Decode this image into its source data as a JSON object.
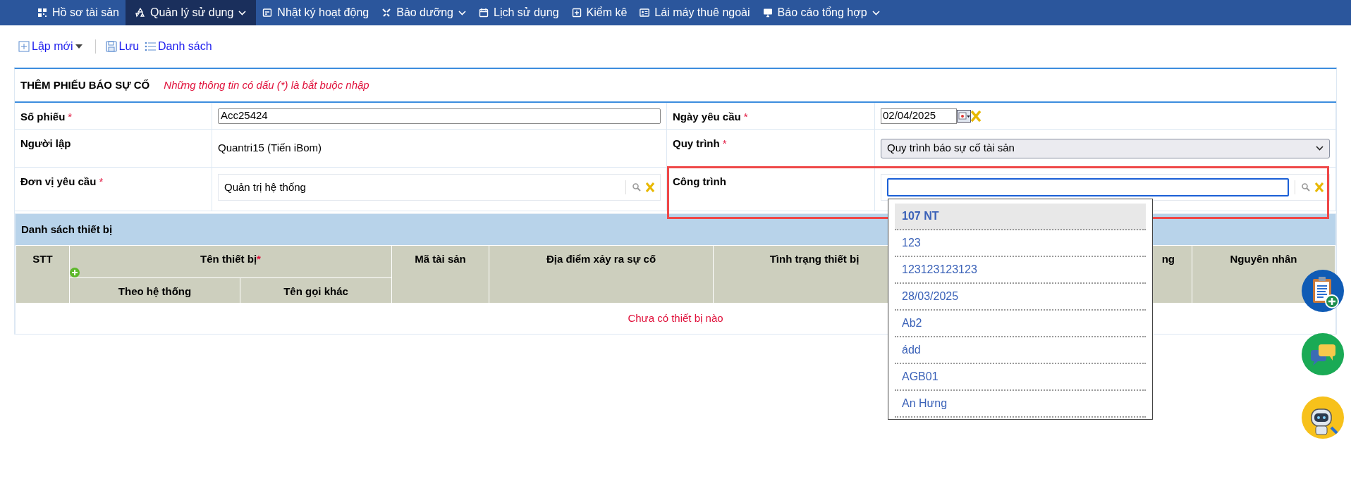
{
  "nav": [
    {
      "label": "Hồ sơ tài sản",
      "caret": false,
      "selected": false
    },
    {
      "label": "Quản lý sử dụng",
      "caret": true,
      "selected": true
    },
    {
      "label": "Nhật ký hoạt động",
      "caret": false,
      "selected": false
    },
    {
      "label": "Bảo dưỡng",
      "caret": true,
      "selected": false
    },
    {
      "label": "Lịch sử dụng",
      "caret": false,
      "selected": false
    },
    {
      "label": "Kiểm kê",
      "caret": false,
      "selected": false
    },
    {
      "label": "Lái máy thuê ngoài",
      "caret": false,
      "selected": false
    },
    {
      "label": "Báo cáo tổng hợp",
      "caret": true,
      "selected": false
    }
  ],
  "toolbar": [
    {
      "label": "Lập mới",
      "caret": true
    },
    {
      "label": "Lưu",
      "caret": false
    },
    {
      "label": "Danh sách",
      "caret": false
    }
  ],
  "form": {
    "title": "THÊM PHIẾU BÁO SỰ CỐ",
    "note": "Những thông tin có dấu (*) là bắt buộc nhập",
    "fields": [
      {
        "label": "Số phiếu",
        "required_mark": "*",
        "kind": "text",
        "value": "Acc25424"
      },
      {
        "label": "Ngày yêu cầu",
        "required_mark": "*",
        "kind": "date",
        "value": "02/04/2025"
      },
      {
        "label": "Người lập",
        "kind": "static",
        "value": "Quantri15 (Tiến iBom)"
      },
      {
        "label": "Quy trình",
        "required_mark": "*",
        "kind": "select",
        "value": "Quy trình báo sự cố tài sản"
      },
      {
        "label": "Đơn vị yêu cầu",
        "required_mark": "*",
        "kind": "lookup",
        "value": "Quản trị hệ thống",
        "focused": false
      },
      {
        "label": "Công trình",
        "kind": "lookup",
        "focused": true
      }
    ]
  },
  "dropdown": {
    "items": [
      {
        "label": "107 NT",
        "selected": true
      },
      {
        "label": "123",
        "selected": false
      },
      {
        "label": "123123123123",
        "selected": false
      },
      {
        "label": "28/03/2025",
        "selected": false
      },
      {
        "label": "Ab2",
        "selected": false
      },
      {
        "label": "ádd",
        "selected": false
      },
      {
        "label": "AGB01",
        "selected": false
      },
      {
        "label": "An Hưng",
        "selected": false
      }
    ]
  },
  "table": {
    "title": "Danh sách thiết bị",
    "columns": [
      {
        "label": "STT"
      },
      {
        "label": "Tên thiết bị",
        "required_mark": "*",
        "children": [
          {
            "label": "Theo hệ thống"
          },
          {
            "label": "Tên gọi khác"
          }
        ]
      },
      {
        "label": "Mã tài sản"
      },
      {
        "label": "Địa điểm xảy ra sự cố"
      },
      {
        "label": "Tình trạng thiết bị"
      },
      {
        "label": "ng"
      },
      {
        "label": "Nguyên nhân"
      }
    ],
    "empty_message": "Chưa có thiết bị nào"
  }
}
